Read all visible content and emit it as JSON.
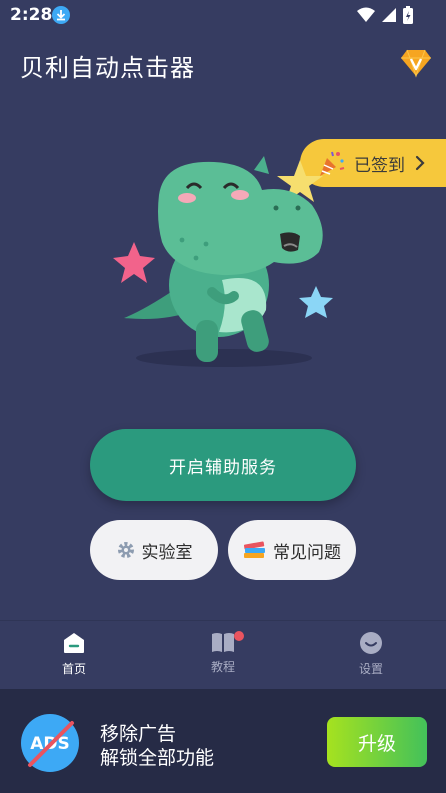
{
  "status": {
    "time": "2:28"
  },
  "header": {
    "title": "贝利自动点击器"
  },
  "checkin": {
    "label": "已签到"
  },
  "actions": {
    "primary_label": "开启辅助服务",
    "lab_label": "实验室",
    "faq_label": "常见问题"
  },
  "nav": [
    {
      "label": "首页",
      "icon": "home-icon",
      "active": true
    },
    {
      "label": "教程",
      "icon": "book-icon",
      "badge": true
    },
    {
      "label": "设置",
      "icon": "smile-icon"
    }
  ],
  "ads": {
    "line1": "移除广告",
    "line2": "解锁全部功能",
    "upgrade_label": "升级"
  },
  "colors": {
    "background": "#363C61",
    "primary": "#2B9A7E",
    "badge": "#F6C83C",
    "nav_active": "#FFFFFF",
    "nav_inactive": "#A9ADC4",
    "ads_bg": "#262B46"
  }
}
